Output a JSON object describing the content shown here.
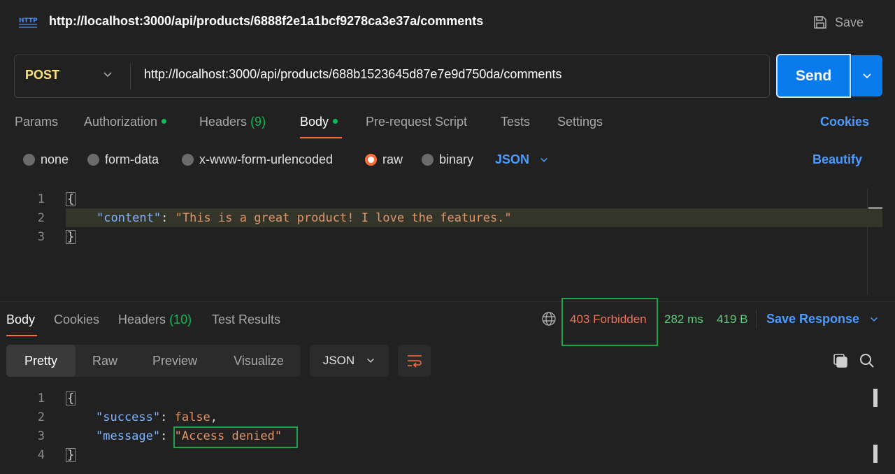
{
  "header": {
    "icon": "http-icon",
    "icon_text": "HTTP",
    "title": "http://localhost:3000/api/products/6888f2e1a1bcf9278ca3e37a/comments",
    "save_label": "Save"
  },
  "request": {
    "method": "POST",
    "url": "http://localhost:3000/api/products/688b1523645d87e7e9d750da/comments",
    "send_label": "Send"
  },
  "req_tabs": {
    "params": "Params",
    "authorization": "Authorization",
    "headers": "Headers",
    "headers_count": "(9)",
    "body": "Body",
    "prerequest": "Pre-request Script",
    "tests": "Tests",
    "settings": "Settings",
    "cookies": "Cookies"
  },
  "body_types": {
    "none": "none",
    "form_data": "form-data",
    "urlencoded": "x-www-form-urlencoded",
    "raw": "raw",
    "binary": "binary",
    "format": "JSON",
    "beautify": "Beautify"
  },
  "request_body": {
    "lines": [
      "1",
      "2",
      "3"
    ],
    "open": "{",
    "key": "\"content\"",
    "colon": ": ",
    "value": "\"This is a great product! I love the features.\"",
    "close": "}"
  },
  "response": {
    "tabs": {
      "body": "Body",
      "cookies": "Cookies",
      "headers": "Headers",
      "headers_count": "(10)",
      "test_results": "Test Results"
    },
    "status": "403 Forbidden",
    "time": "282 ms",
    "size": "419 B",
    "save_response": "Save Response",
    "views": {
      "pretty": "Pretty",
      "raw": "Raw",
      "preview": "Preview",
      "visualize": "Visualize"
    },
    "format": "JSON",
    "body": {
      "lines": [
        "1",
        "2",
        "3",
        "4"
      ],
      "open": "{",
      "key1": "\"success\"",
      "val1": "false",
      "comma": ",",
      "key2": "\"message\"",
      "val2": "\"Access denied\"",
      "colon": ": ",
      "close": "}"
    }
  },
  "colors": {
    "accent": "#ff6c37",
    "send": "#097bed",
    "status_error": "#f2735a",
    "status_ok": "#5bcc7a",
    "highlight_box": "#1fa34a"
  }
}
